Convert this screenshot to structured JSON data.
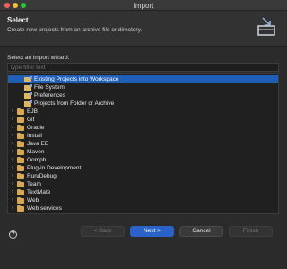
{
  "window": {
    "title": "Import"
  },
  "header": {
    "title": "Select",
    "description": "Create new projects from an archive file or directory."
  },
  "wizard": {
    "label": "Select an import wizard:",
    "filter_placeholder": "type filter text"
  },
  "tree": {
    "expanded_group_children": [
      {
        "label": "Existing Projects into Workspace",
        "selected": true
      },
      {
        "label": "File System",
        "selected": false
      },
      {
        "label": "Preferences",
        "selected": false
      },
      {
        "label": "Projects from Folder or Archive",
        "selected": false
      }
    ],
    "groups": [
      "EJB",
      "Git",
      "Gradle",
      "Install",
      "Java EE",
      "Maven",
      "Oomph",
      "Plug-in Development",
      "Run/Debug",
      "Team",
      "TextMate",
      "Web",
      "Web services"
    ]
  },
  "buttons": {
    "back": "< Back",
    "next": "Next >",
    "cancel": "Cancel",
    "finish": "Finish"
  },
  "colors": {
    "selection": "#1f5fb8",
    "primary_button": "#2a62c9"
  }
}
